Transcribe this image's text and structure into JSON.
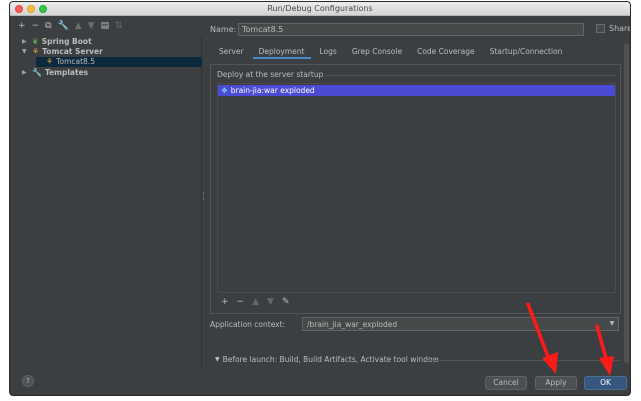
{
  "window": {
    "title": "Run/Debug Configurations"
  },
  "toolbar": {
    "add": "+",
    "remove": "−",
    "copy": "⧉",
    "edit": "🔧",
    "up": "▲",
    "down": "▼",
    "folder": "▤",
    "sort": "⇅"
  },
  "tree": {
    "spring_boot": "Spring Boot",
    "tomcat_server": "Tomcat Server",
    "tomcat85": "Tomcat8.5",
    "templates": "Templates"
  },
  "config": {
    "name_label": "Name:",
    "name_value": "Tomcat8.5",
    "share_label": "Share",
    "tabs": [
      {
        "label": "Server"
      },
      {
        "label": "Deployment"
      },
      {
        "label": "Logs"
      },
      {
        "label": "Grep Console"
      },
      {
        "label": "Code Coverage"
      },
      {
        "label": "Startup/Connection"
      }
    ],
    "deploy_label": "Deploy at the server startup",
    "deploy_item": "brain-jia:war exploded",
    "deploy_tb": {
      "add": "+",
      "remove": "−",
      "up": "▲",
      "down": "▼",
      "edit": "✎"
    },
    "context_label": "Application context:",
    "context_value": "/brain_jia_war_exploded",
    "before_launch": "Before launch: Build, Build Artifacts, Activate tool window"
  },
  "buttons": {
    "help": "?",
    "cancel": "Cancel",
    "apply": "Apply",
    "ok": "OK"
  },
  "colors": {
    "background": "#3c3f41",
    "selection": "#4b4bd6",
    "ok_button": "#365880",
    "annotation": "#ff1a1a"
  }
}
